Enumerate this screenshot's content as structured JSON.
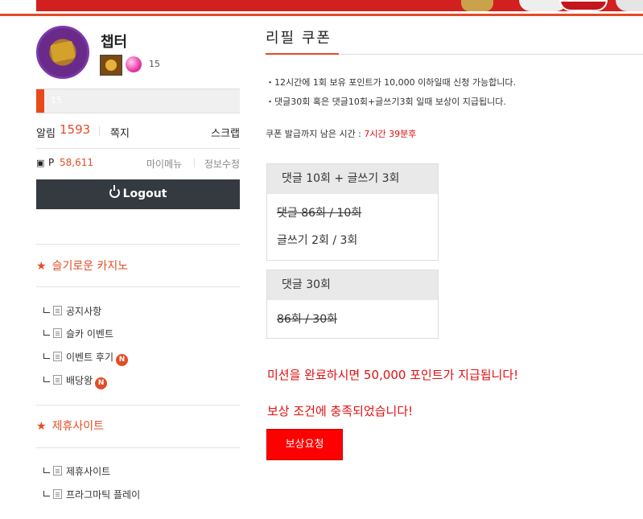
{
  "profile": {
    "nickname": "챕터",
    "level": "15",
    "exp_label": "15",
    "exp_fraction": 0.04
  },
  "account": {
    "alarm_label": "알림",
    "alarm_count": "1593",
    "memo_label": "쪽지",
    "scrap_label": "스크랩",
    "point_prefix": "P",
    "point_value": "58,611",
    "mymenu_label": "마이메뉴",
    "editinfo_label": "정보수정",
    "logout_label": "Logout"
  },
  "sections": [
    {
      "title": "슬기로운 카지노",
      "items": [
        {
          "label": "공지사항",
          "new": false
        },
        {
          "label": "슬카 이벤트",
          "new": false
        },
        {
          "label": "이벤트 후기",
          "new": true
        },
        {
          "label": "배당왕",
          "new": true
        }
      ]
    },
    {
      "title": "제휴사이트",
      "items": [
        {
          "label": "제휴사이트",
          "new": false
        },
        {
          "label": "프라그마틱 플레이",
          "new": false
        }
      ]
    }
  ],
  "new_badge": "N",
  "coupon": {
    "title": "리필 쿠폰",
    "rules": [
      "・12시간에 1회 보유 포인트가 10,000 이하일때 신청 가능합니다.",
      "・댓글30회 혹은 댓글10회+글쓰기3회 일때 보상이 지급됩니다."
    ],
    "timer_label": "쿠폰 발급까지 남은 시간 : ",
    "timer_value": "7시간 39분후",
    "missions": [
      {
        "head": "댓글 10회 + 글쓰기 3회",
        "lines": [
          {
            "text": "댓글 86회 / 10회",
            "done": true
          },
          {
            "text": "글쓰기 2회 / 3회",
            "done": false
          }
        ]
      },
      {
        "head": "댓글 30회",
        "lines": [
          {
            "text": "86회 / 30회",
            "done": true
          }
        ]
      }
    ],
    "complete_msg": "미션을 완료하시면 50,000 포인트가 지급됩니다!",
    "reward_msg": "보상 조건에 충족되었습니다!",
    "reward_button": "보상요청"
  },
  "colors": {
    "accent": "#e34c26",
    "danger": "#ff0000",
    "logout_bg": "#343a40"
  }
}
